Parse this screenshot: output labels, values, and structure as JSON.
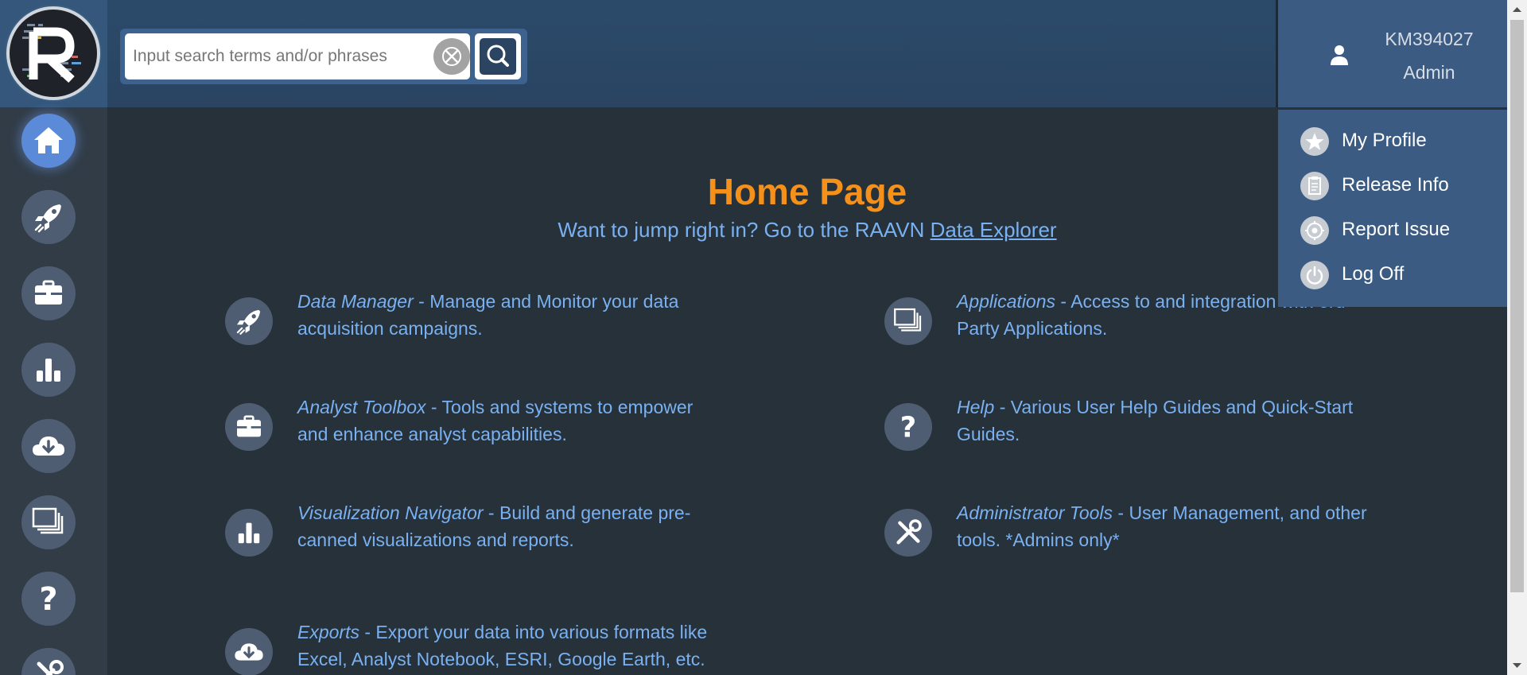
{
  "header": {
    "search": {
      "placeholder": "Input search terms and/or phrases",
      "value": ""
    },
    "user": {
      "name": "KM394027",
      "role": "Admin"
    }
  },
  "user_menu": {
    "items": [
      {
        "label": "My Profile",
        "icon": "star-icon"
      },
      {
        "label": "Release Info",
        "icon": "clipboard-icon"
      },
      {
        "label": "Report Issue",
        "icon": "bug-icon"
      },
      {
        "label": "Log Off",
        "icon": "power-icon"
      }
    ]
  },
  "sidebar": {
    "items": [
      {
        "icon": "home-icon",
        "active": true
      },
      {
        "icon": "rocket-icon",
        "active": false
      },
      {
        "icon": "toolbox-icon",
        "active": false
      },
      {
        "icon": "bar-chart-icon",
        "active": false
      },
      {
        "icon": "cloud-download-icon",
        "active": false
      },
      {
        "icon": "windows-stack-icon",
        "active": false
      },
      {
        "icon": "question-icon",
        "active": false
      },
      {
        "icon": "tools-icon",
        "active": false
      }
    ]
  },
  "main": {
    "title": "Home Page",
    "subtitle_prefix": "Want to jump right in? Go to the RAAVN ",
    "subtitle_link": "Data Explorer",
    "features": [
      {
        "name": "Data Manager",
        "desc": " - Manage and Monitor your data acquisition campaigns.",
        "icon": "rocket-icon"
      },
      {
        "name": "Applications",
        "desc": " - Access to and integration with 3rd-Party Applications.",
        "icon": "windows-stack-icon"
      },
      {
        "name": "Analyst Toolbox",
        "desc": " - Tools and systems to empower and enhance analyst capabilities.",
        "icon": "toolbox-icon"
      },
      {
        "name": "Help",
        "desc": " - Various User Help Guides and Quick-Start Guides.",
        "icon": "question-icon"
      },
      {
        "name": "Visualization Navigator",
        "desc": " - Build and generate pre-canned visualizations and reports.",
        "icon": "bar-chart-icon"
      },
      {
        "name": "Administrator Tools",
        "desc": " - User Management, and other tools. *Admins only*",
        "icon": "tools-icon"
      },
      {
        "name": "Exports",
        "desc": " - Export your data into various formats like Excel, Analyst Notebook, ESRI, Google Earth, etc.",
        "icon": "cloud-download-icon"
      }
    ]
  },
  "colors": {
    "accent": "#f5901b",
    "link": "#79b1f2",
    "header": "#2a4462",
    "background": "#273139"
  }
}
